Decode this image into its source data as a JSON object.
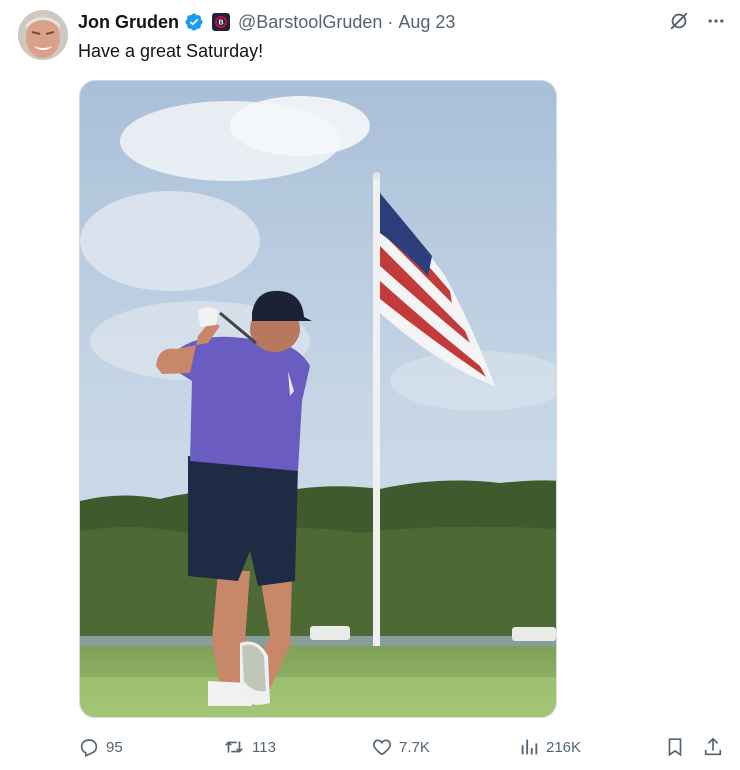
{
  "tweet": {
    "author_name": "Jon Gruden",
    "handle": "@BarstoolGruden",
    "separator": "·",
    "date": "Aug 23",
    "text": "Have a great Saturday!"
  },
  "icons": {
    "verified": "verified-badge-icon",
    "affiliate": "barstool-affiliate-badge-icon",
    "grok": "grok-icon",
    "more": "more-icon",
    "reply": "reply-icon",
    "repost": "repost-icon",
    "like": "like-icon",
    "views": "views-icon",
    "bookmark": "bookmark-icon",
    "share": "share-icon"
  },
  "actions": {
    "replies": "95",
    "reposts": "113",
    "likes": "7.7K",
    "views": "216K"
  },
  "colors": {
    "verified_blue": "#1d9bf0",
    "secondary_text": "#536471",
    "primary_text": "#0f1419"
  }
}
